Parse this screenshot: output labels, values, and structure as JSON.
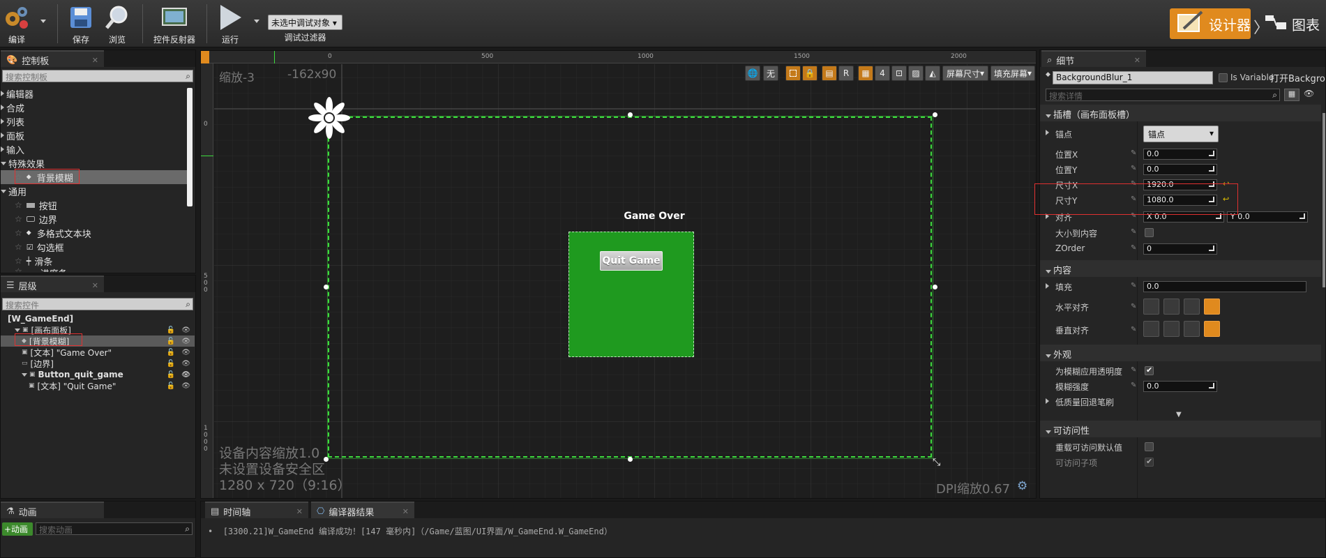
{
  "toolbar": {
    "compile": "编译",
    "save": "保存",
    "browse": "浏览",
    "reflector": "控件反射器",
    "play": "运行",
    "debug_select": "未选中调试对象",
    "debug_filter": "调试过滤器",
    "designer": "设计器",
    "graph": "图表"
  },
  "palette": {
    "tab": "控制板",
    "search_placeholder": "搜索控制板",
    "categories": [
      "编辑器",
      "合成",
      "列表",
      "面板",
      "输入",
      "特殊效果"
    ],
    "selected_item": "背景模糊",
    "common_category": "通用",
    "common_items": [
      "按钮",
      "边界",
      "多格式文本块",
      "勾选框",
      "滑条"
    ],
    "cut_item": "进度条"
  },
  "hierarchy": {
    "tab": "层级",
    "search_placeholder": "搜索控件",
    "items": [
      {
        "label": "[W_GameEnd]",
        "indent": 0
      },
      {
        "label": "[画布面板]",
        "indent": 1
      },
      {
        "label": "[背景模糊]",
        "indent": 2
      },
      {
        "label": "[文本] \"Game Over\"",
        "indent": 2
      },
      {
        "label": "[边界]",
        "indent": 2
      },
      {
        "label": "Button_quit_game",
        "indent": 2
      },
      {
        "label": "[文本] \"Quit Game\"",
        "indent": 3
      }
    ]
  },
  "viewport": {
    "zoom": "缩放-3",
    "size": "-162x90",
    "ruler_labels": [
      "0",
      "500",
      "1000",
      "1500",
      "2000"
    ],
    "ruler_v_labels": [
      "0",
      "500",
      "1000"
    ],
    "device_scale": "设备内容缩放1.0",
    "safe_zone": "未设置设备安全区",
    "resolution": "1280 x 720（9:16）",
    "dpi": "DPI缩放0.67",
    "game_over": "Game Over",
    "quit_game": "Quit Game",
    "screen_size": "屏幕尺寸",
    "fill_screen": "填充屏幕",
    "none_label": "无",
    "r_label": "R",
    "four_label": "4"
  },
  "details": {
    "tab": "细节",
    "name": "BackgroundBlur_1",
    "is_variable": "Is Variable",
    "open_link": "打开Backgrou",
    "search_placeholder": "搜索详情",
    "slot_header": "插槽（画布面板槽）",
    "anchor_label": "锚点",
    "anchor_value": "锚点",
    "pos_x_label": "位置X",
    "pos_x": "0.0",
    "pos_y_label": "位置Y",
    "pos_y": "0.0",
    "size_x_label": "尺寸X",
    "size_x": "1920.0",
    "size_y_label": "尺寸Y",
    "size_y": "1080.0",
    "align_label": "对齐",
    "align_x": "X  0.0",
    "align_y": "Y  0.0",
    "size_to_content": "大小到内容",
    "zorder_label": "ZOrder",
    "zorder": "0",
    "content_header": "内容",
    "padding_label": "填充",
    "padding": "0.0",
    "h_align": "水平对齐",
    "v_align": "垂直对齐",
    "appearance_header": "外观",
    "apply_alpha": "为模糊应用透明度",
    "blur_strength_label": "模糊强度",
    "blur_strength": "0.0",
    "low_quality": "低质量回退笔刷",
    "accessibility_header": "可访问性",
    "override_access": "重载可访问默认值",
    "access_children": "可访问子项"
  },
  "bottom": {
    "anim_tab": "动画",
    "add_anim": "+动画",
    "search_anim": "搜索动画",
    "timeline_tab": "时间轴",
    "compiler_tab": "编译器结果",
    "log": "[3300.21]W_GameEnd 编译成功！[147 毫秒内]（/Game/蓝图/UI界面/W_GameEnd.W_GameEnd）"
  },
  "colors": {
    "accent": "#e08a1e",
    "widget_green": "#1f9a1f",
    "selection_green": "#3ddc3d"
  }
}
